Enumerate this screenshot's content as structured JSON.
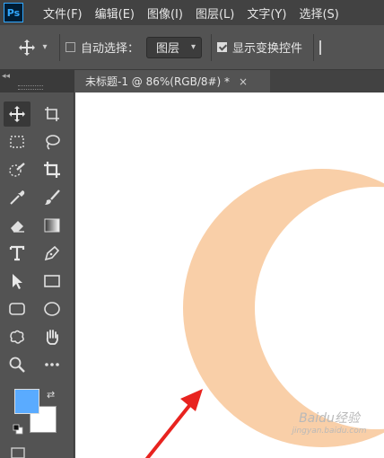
{
  "app": {
    "logo": "Ps",
    "menu": [
      "文件(F)",
      "编辑(E)",
      "图像(I)",
      "图层(L)",
      "文字(Y)",
      "选择(S)"
    ]
  },
  "options": {
    "auto_select_label": "自动选择：",
    "auto_select_checked": false,
    "target_value": "图层",
    "show_transform_label": "显示变换控件",
    "show_transform_checked": true
  },
  "toolbar": {
    "collapse": "◂◂",
    "tools": [
      "move-icon",
      "artboard-icon",
      "marquee-icon",
      "lasso-icon",
      "quick-select-icon",
      "crop-icon",
      "eyedropper-icon",
      "brush-icon",
      "eraser-icon",
      "gradient-icon",
      "type-icon",
      "pen-icon",
      "path-select-icon",
      "rectangle-icon",
      "rounded-rect-icon",
      "ellipse-icon",
      "custom-shape-icon",
      "hand-icon",
      "zoom-icon",
      "more-icon"
    ],
    "foreground_color": "#5aabff",
    "background_color": "#ffffff"
  },
  "document": {
    "tab_title": "未标题-1 @ 86%(RGB/8#) *",
    "close_symbol": "×"
  },
  "canvas": {
    "background_color": "#ffffff",
    "moon_color": "#f9cfa8",
    "arrow_color": "#e8231f"
  },
  "watermark": {
    "text": "Baidu经验",
    "sub": "jingyan.baidu.com"
  }
}
